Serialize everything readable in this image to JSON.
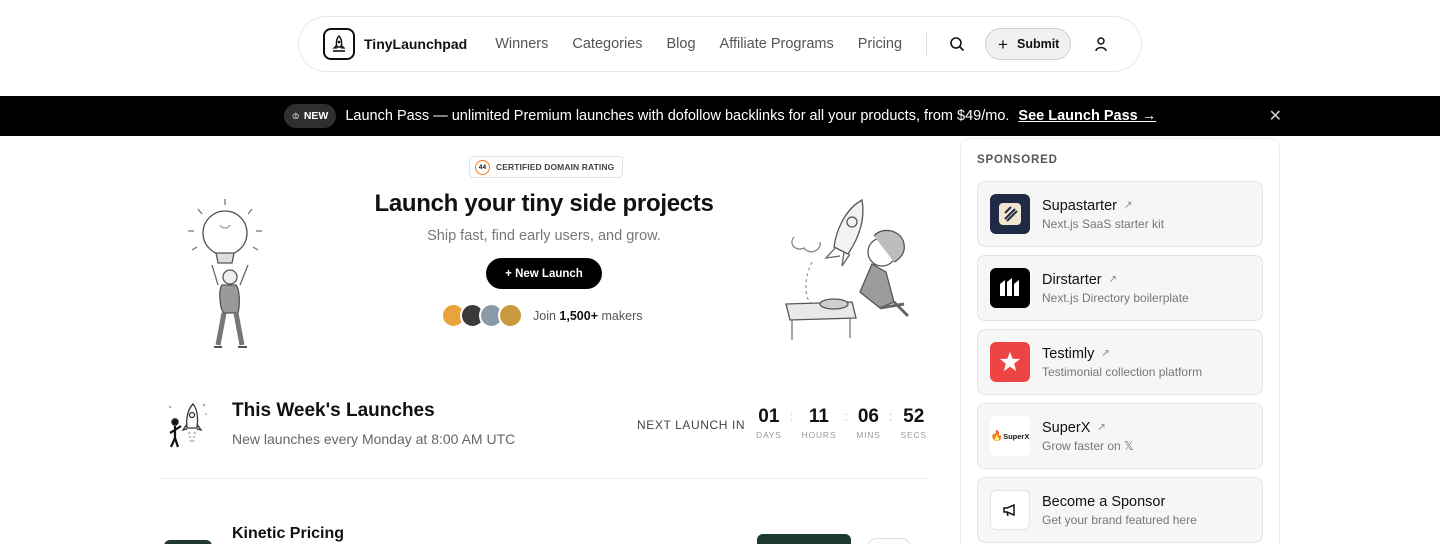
{
  "nav": {
    "brand": "TinyLaunchpad",
    "links": [
      "Winners",
      "Categories",
      "Blog",
      "Affiliate Programs",
      "Pricing"
    ],
    "submit_label": "Submit",
    "icons": [
      "rocket-logo-icon",
      "search-icon",
      "plus-icon",
      "user-icon"
    ]
  },
  "banner": {
    "badge": "NEW",
    "text": "Launch Pass — unlimited Premium launches with dofollow backlinks for all your products, from $49/mo.",
    "link": "See Launch Pass →"
  },
  "hero": {
    "domain_rating": "44",
    "badge_text": "CERTIFIED DOMAIN RATING",
    "title": "Launch your tiny side projects",
    "subtitle": "Ship fast, find early users, and grow.",
    "cta": "+ New Launch",
    "makers_prefix": "Join",
    "makers_count": "1,500+",
    "makers_suffix": "makers"
  },
  "launches": {
    "title": "This Week's Launches",
    "subtitle": "New launches every Monday at 8:00 AM UTC",
    "next_label": "NEXT LAUNCH IN",
    "countdown": [
      {
        "value": "01",
        "label": "DAYS"
      },
      {
        "value": "11",
        "label": "HOURS"
      },
      {
        "value": "06",
        "label": "MINS"
      },
      {
        "value": "52",
        "label": "SECS"
      }
    ],
    "first_product": "Kinetic Pricing"
  },
  "sponsored": {
    "label": "SPONSORED",
    "items": [
      {
        "name": "Supastarter",
        "desc": "Next.js SaaS starter kit"
      },
      {
        "name": "Dirstarter",
        "desc": "Next.js Directory boilerplate"
      },
      {
        "name": "Testimly",
        "desc": "Testimonial collection platform"
      },
      {
        "name": "SuperX",
        "desc": "Grow faster on 𝕏",
        "logo_text": "SuperX"
      },
      {
        "name": "Become a Sponsor",
        "desc": "Get your brand featured here"
      }
    ]
  },
  "colors": {
    "banner_bg": "#000000",
    "accent_orange": "#f97316",
    "testimly_red": "#ef4444",
    "supastarter_bg": "#1f2a44"
  }
}
